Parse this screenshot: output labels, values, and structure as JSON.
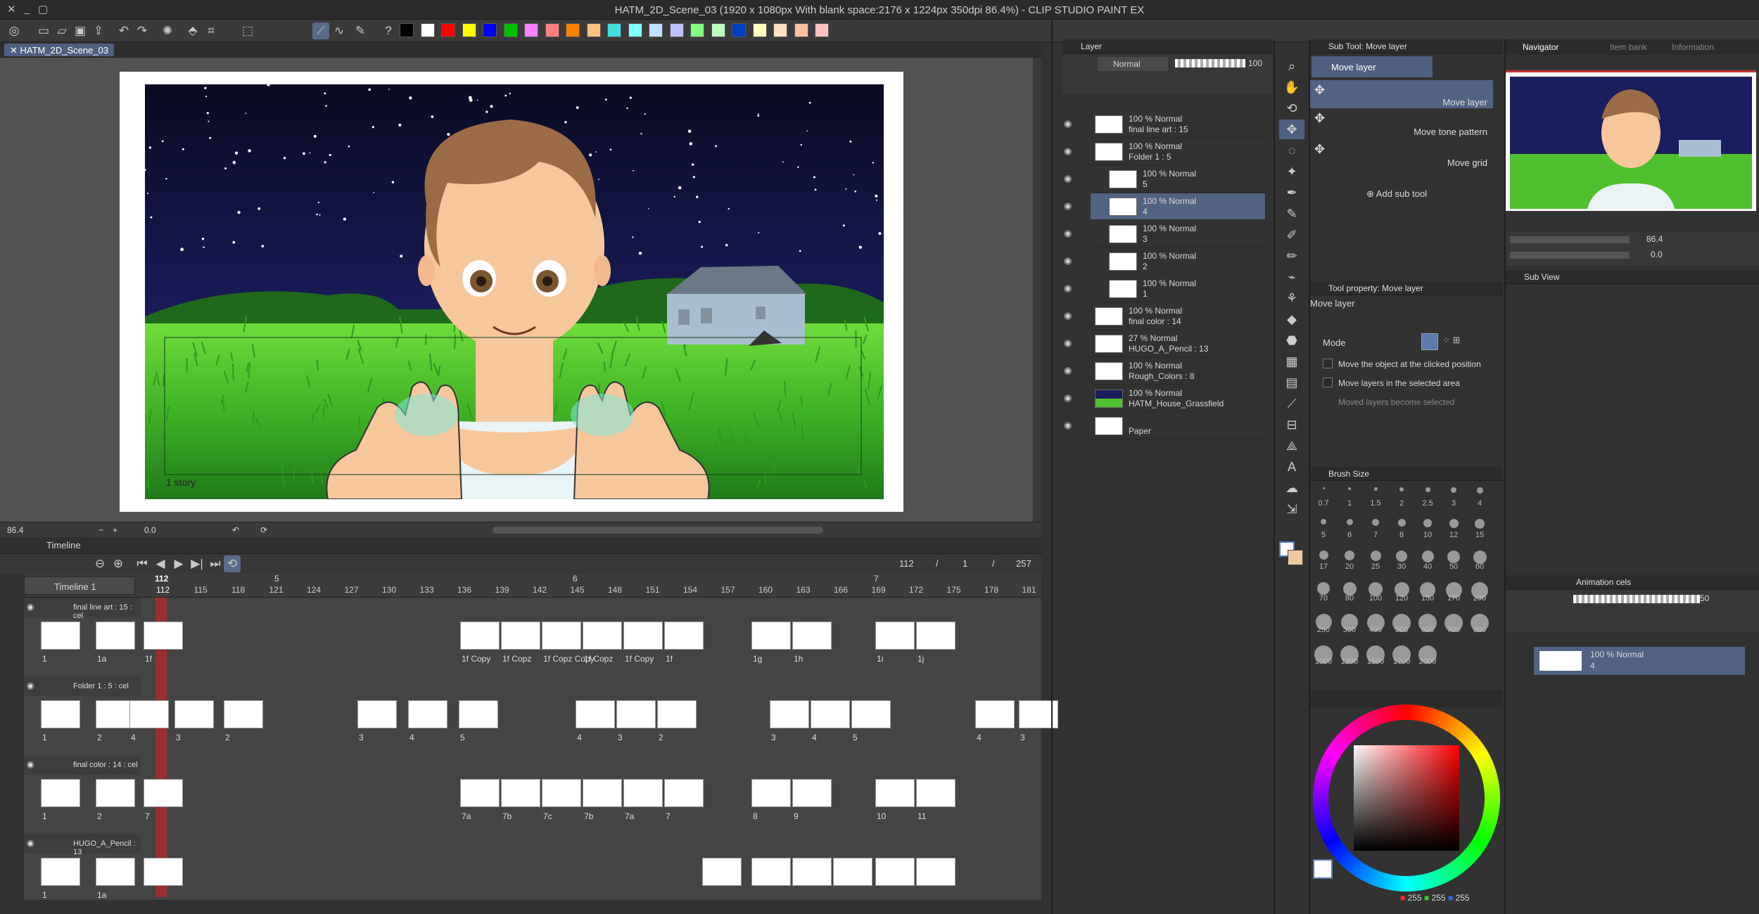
{
  "window": {
    "title": "HATM_2D_Scene_03 (1920 x 1080px With blank space:2176 x 1224px 350dpi 86.4%) - CLIP STUDIO PAINT EX"
  },
  "document_tab": {
    "label": "HATM_2D_Scene_03"
  },
  "palette_colors": [
    "#000000",
    "#ffffff",
    "#ff0000",
    "#ffff00",
    "#0000ff",
    "#00c000",
    "#ff80ff",
    "#ff8080",
    "#ff8000",
    "#ffc080",
    "#40e0e0",
    "#80ffff",
    "#c0e0ff",
    "#c0c0ff",
    "#80ff80",
    "#c0ffc0",
    "#0040c0",
    "#ffffc0",
    "#ffe0c0",
    "#ffc0a0",
    "#ffc0c0"
  ],
  "canvas": {
    "story_label": "1 story"
  },
  "canvas_status": {
    "zoom": "86.4",
    "rotation": "0.0"
  },
  "timeline": {
    "panel_title": "Timeline",
    "name": "Timeline 1",
    "current_frame_marker": "112",
    "frame_counter": {
      "current": "112",
      "start": "1",
      "end": "257"
    },
    "ruler_frames": [
      "112",
      "115",
      "118",
      "121",
      "124",
      "127",
      "130",
      "133",
      "136",
      "139",
      "142",
      "145",
      "148",
      "151",
      "154",
      "157",
      "160",
      "163",
      "166",
      "169",
      "172",
      "175",
      "178",
      "181"
    ],
    "section_markers": [
      "5",
      "6",
      "7"
    ],
    "tracks": [
      {
        "name": "final line art : 15 : cel",
        "labels_left": [
          "1",
          "1a",
          "1f"
        ],
        "labels_right": [
          "1f Copy",
          "1f Copz",
          "1f Copz Copy",
          "1f Copz",
          "1f Copy",
          "1f",
          "1g",
          "1h",
          "1i",
          "1j"
        ]
      },
      {
        "name": "Folder 1 : 5 : cel",
        "labels_left": [
          "1",
          "2",
          "4",
          "3",
          "2"
        ],
        "labels_right": [
          "3",
          "4",
          "5",
          "4",
          "3",
          "2",
          "3",
          "4",
          "5",
          "4",
          "3"
        ]
      },
      {
        "name": "final color : 14 : cel",
        "labels_left": [
          "1",
          "2",
          "7"
        ],
        "labels_right": [
          "7a",
          "7b",
          "7c",
          "7b",
          "7a",
          "7",
          "8",
          "9",
          "10",
          "11"
        ]
      },
      {
        "name": "HUGO_A_Pencil : 13",
        "labels_left": [
          "1",
          "1a"
        ],
        "labels_right": []
      }
    ]
  },
  "layer_panel": {
    "title": "Layer",
    "blend_mode": "Normal",
    "opacity": "100",
    "layers": [
      {
        "opacity_mode": "100 % Normal",
        "name": "final line art : 15"
      },
      {
        "opacity_mode": "100 % Normal",
        "name": "Folder 1 : 5"
      },
      {
        "opacity_mode": "100 % Normal",
        "name": "5"
      },
      {
        "opacity_mode": "100 % Normal",
        "name": "4"
      },
      {
        "opacity_mode": "100 % Normal",
        "name": "3"
      },
      {
        "opacity_mode": "100 % Normal",
        "name": "2"
      },
      {
        "opacity_mode": "100 % Normal",
        "name": "1"
      },
      {
        "opacity_mode": "100 % Normal",
        "name": "final color : 14"
      },
      {
        "opacity_mode": "27 % Normal",
        "name": "HUGO_A_Pencil : 13"
      },
      {
        "opacity_mode": "100 % Normal",
        "name": "Rough_Colors : 8"
      },
      {
        "opacity_mode": "100 % Normal",
        "name": "HATM_House_Grassfield"
      },
      {
        "opacity_mode": "",
        "name": "Paper"
      }
    ]
  },
  "sub_tool": {
    "title": "Sub Tool: Move layer",
    "group_label": "Move layer",
    "items": [
      "Move layer",
      "Move tone pattern",
      "Move grid"
    ],
    "add_label": "Add sub tool"
  },
  "tool_property": {
    "title": "Tool property: Move layer",
    "tool_name": "Move layer",
    "mode_label": "Mode",
    "options": [
      "Move the object at the clicked position",
      "Move layers in the selected area",
      "Moved layers become selected"
    ]
  },
  "brush_size": {
    "title": "Brush Size",
    "sizes": [
      "0.7",
      "1",
      "1.5",
      "2",
      "2.5",
      "3",
      "4",
      "5",
      "6",
      "7",
      "8",
      "10",
      "12",
      "15",
      "17",
      "20",
      "25",
      "30",
      "40",
      "50",
      "60",
      "70",
      "80",
      "100",
      "120",
      "150",
      "170",
      "200",
      "250",
      "300",
      "400",
      "500",
      "600",
      "700",
      "800",
      "1000",
      "1200",
      "1500",
      "1700",
      "2000"
    ]
  },
  "navigator": {
    "tabs": [
      "Navigator",
      "Item bank",
      "Information"
    ],
    "zoom": "86.4",
    "rotation": "0.0"
  },
  "sub_view": {
    "title": "Sub View"
  },
  "animation_cels": {
    "title": "Animation cels",
    "value": "50",
    "layer_mode": "100 % Normal",
    "layer_name": "4"
  },
  "color": {
    "r": "255",
    "g": "255",
    "b": "255"
  }
}
